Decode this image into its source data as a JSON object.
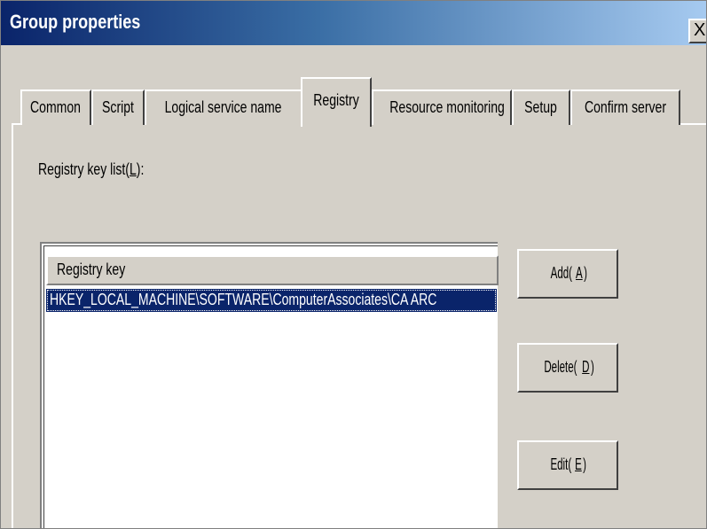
{
  "window": {
    "title": "Group properties",
    "close_glyph": "X"
  },
  "tabs": [
    {
      "label": "Common",
      "active": false
    },
    {
      "label": "Script",
      "active": false
    },
    {
      "label": "Logical service name",
      "active": false
    },
    {
      "label": "Registry",
      "active": true
    },
    {
      "label": "Resource monitoring",
      "active": false
    },
    {
      "label": "Setup",
      "active": false
    },
    {
      "label": "Confirm server",
      "active": false
    }
  ],
  "registry": {
    "list_label_prefix": "Registry key list(",
    "list_label_key": "L",
    "list_label_suffix": "):",
    "column_header": "Registry key",
    "rows": [
      {
        "value": "HKEY_LOCAL_MACHINE\\SOFTWARE\\ComputerAssociates\\CA ARC",
        "selected": true
      }
    ]
  },
  "buttons": {
    "add": {
      "prefix": "Add(",
      "key": "A",
      "suffix": ")"
    },
    "delete": {
      "prefix": "Delete(",
      "key": "D",
      "suffix": ")"
    },
    "edit": {
      "prefix": "Edit(",
      "key": "E",
      "suffix": ")"
    }
  },
  "colors": {
    "title_bar_start": "#0a246a",
    "title_bar_end": "#a6caf0",
    "dialog_face": "#d4d0c8",
    "selection": "#0a246a"
  }
}
